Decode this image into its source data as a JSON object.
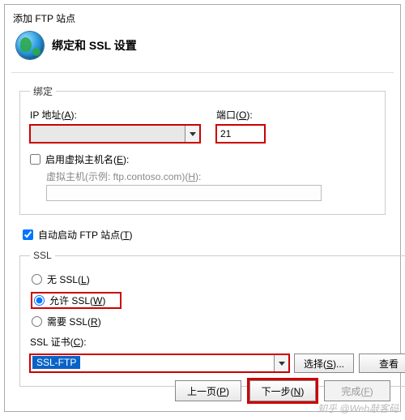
{
  "dialog": {
    "title": "添加 FTP 站点",
    "header_title": "绑定和 SSL 设置"
  },
  "binding": {
    "legend": "绑定",
    "ip_label": "IP 地址(A):",
    "ip_value": "",
    "port_label": "端口(O):",
    "port_value": "21",
    "enable_vhost_label": "启用虚拟主机名(E):",
    "enable_vhost_checked": false,
    "vhost_label": "虚拟主机(示例: ftp.contoso.com)(H):",
    "vhost_value": ""
  },
  "auto_start": {
    "label": "自动启动 FTP 站点(T)",
    "checked": true
  },
  "ssl": {
    "legend": "SSL",
    "no_ssl_label": "无 SSL(L)",
    "allow_ssl_label": "允许 SSL(W)",
    "require_ssl_label": "需要 SSL(R)",
    "selected": "allow",
    "cert_label": "SSL 证书(C):",
    "cert_value": "SSL-FTP",
    "select_btn": "选择(S)...",
    "view_btn": "查看"
  },
  "footer": {
    "prev": "上一页(P)",
    "next": "下一步(N)",
    "finish": "完成(F)"
  },
  "watermark": "知乎 @Web敲客码"
}
